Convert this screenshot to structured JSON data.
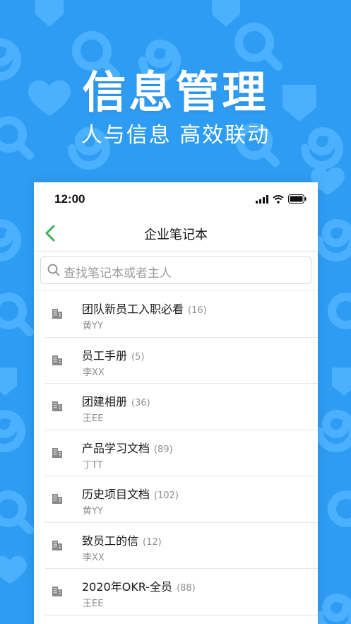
{
  "hero": {
    "title": "信息管理",
    "subtitle": "人与信息 高效联动"
  },
  "colors": {
    "background": "#2e9cf3",
    "pattern": "#4fb3ff",
    "back_arrow": "#3ab054"
  },
  "status_bar": {
    "time": "12:00",
    "icons": [
      "signal-icon",
      "wifi-icon",
      "battery-icon"
    ]
  },
  "nav": {
    "back_icon": "chevron-left-icon",
    "title": "企业笔记本"
  },
  "search": {
    "icon": "search-icon",
    "placeholder": "查找笔记本或者主人"
  },
  "notebooks": [
    {
      "title": "团队新员工入职必看",
      "count": "(16)",
      "owner": "黄YY",
      "icon": "building-icon"
    },
    {
      "title": "员工手册",
      "count": "(5)",
      "owner": "李XX",
      "icon": "building-icon"
    },
    {
      "title": "团建相册",
      "count": "(36)",
      "owner": "王EE",
      "icon": "building-icon"
    },
    {
      "title": "产品学习文档",
      "count": "(89)",
      "owner": "丁TT",
      "icon": "building-icon"
    },
    {
      "title": "历史项目文档",
      "count": "(102)",
      "owner": "黄YY",
      "icon": "building-icon"
    },
    {
      "title": "致员工的信",
      "count": "(12)",
      "owner": "李XX",
      "icon": "building-icon"
    },
    {
      "title": "2020年OKR-全员",
      "count": "(88)",
      "owner": "王EE",
      "icon": "building-icon"
    }
  ]
}
